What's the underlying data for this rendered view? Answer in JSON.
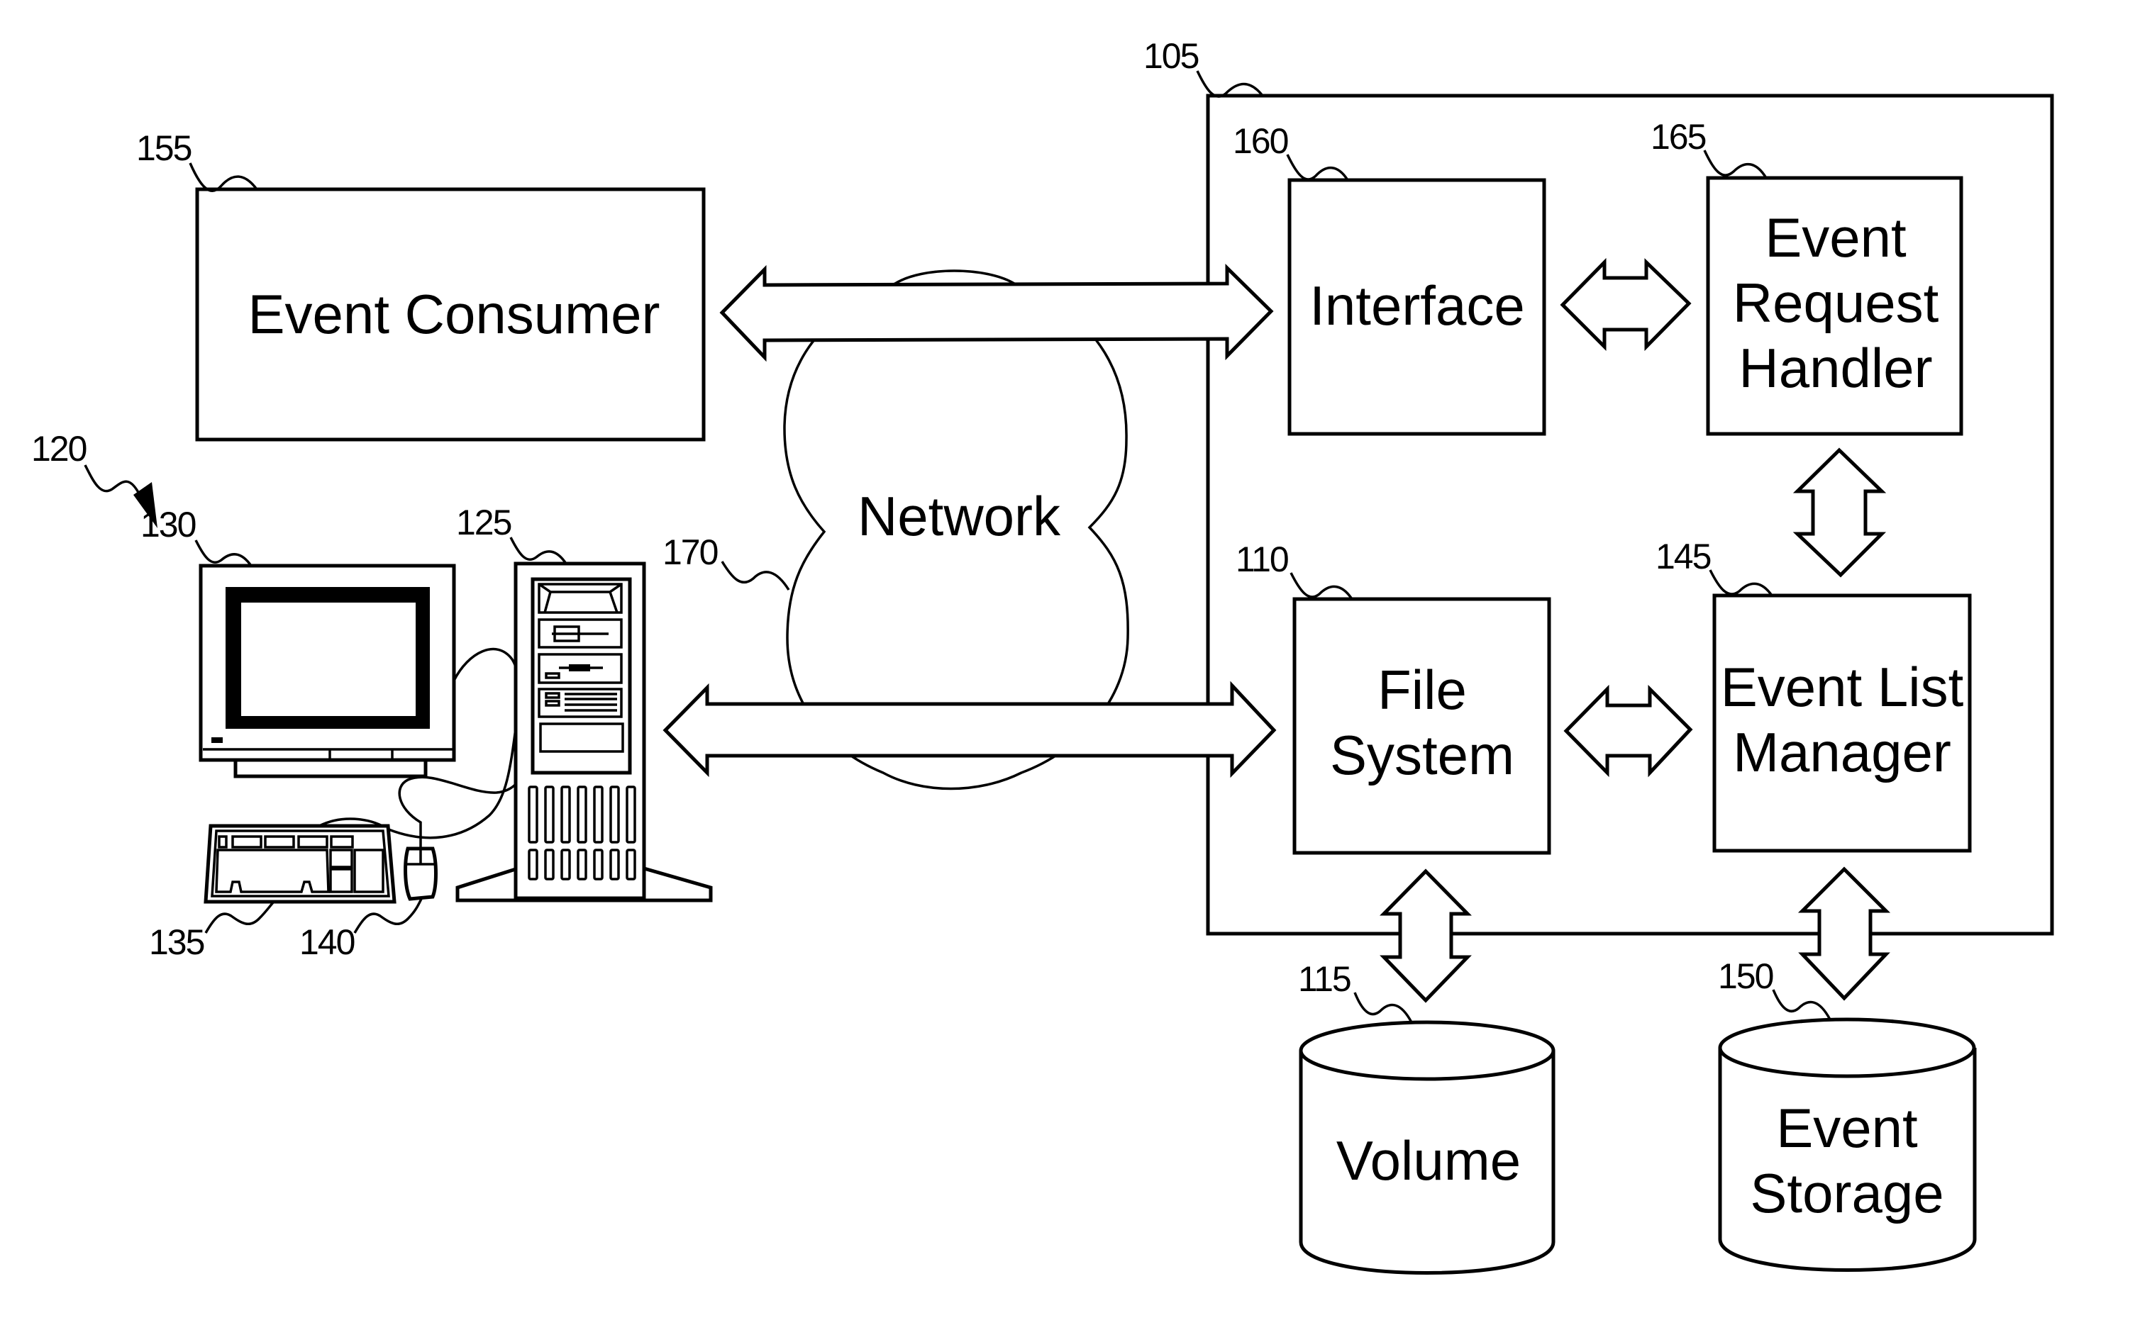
{
  "figure": {
    "components": {
      "event_consumer": {
        "ref": "155",
        "label": "Event Consumer"
      },
      "system": {
        "ref": "105"
      },
      "interface": {
        "ref": "160",
        "label": "Interface"
      },
      "event_request_handler": {
        "ref": "165",
        "lines": [
          "Event",
          "Request",
          "Handler"
        ]
      },
      "file_system": {
        "ref": "110",
        "lines": [
          "File",
          "System"
        ]
      },
      "event_list_manager": {
        "ref": "145",
        "lines": [
          "Event List",
          "Manager"
        ]
      },
      "volume": {
        "ref": "115",
        "label": "Volume"
      },
      "event_storage": {
        "ref": "150",
        "lines": [
          "Event",
          "Storage"
        ]
      },
      "network": {
        "ref": "170",
        "label": "Network"
      },
      "client_computer": {
        "ref": "120"
      },
      "monitor": {
        "ref": "130"
      },
      "tower": {
        "ref": "125"
      },
      "keyboard": {
        "ref": "135"
      },
      "mouse": {
        "ref": "140"
      }
    },
    "connections": [
      {
        "from": "Event Consumer",
        "to": "Interface",
        "via": "Network",
        "type": "bidirectional"
      },
      {
        "from": "Client Computer",
        "to": "File System",
        "via": "Network",
        "type": "bidirectional"
      },
      {
        "from": "Interface",
        "to": "Event Request Handler",
        "type": "bidirectional"
      },
      {
        "from": "Event Request Handler",
        "to": "Event List Manager",
        "type": "bidirectional"
      },
      {
        "from": "File System",
        "to": "Event List Manager",
        "type": "bidirectional"
      },
      {
        "from": "File System",
        "to": "Volume",
        "type": "bidirectional"
      },
      {
        "from": "Event List Manager",
        "to": "Event Storage",
        "type": "bidirectional"
      }
    ]
  }
}
